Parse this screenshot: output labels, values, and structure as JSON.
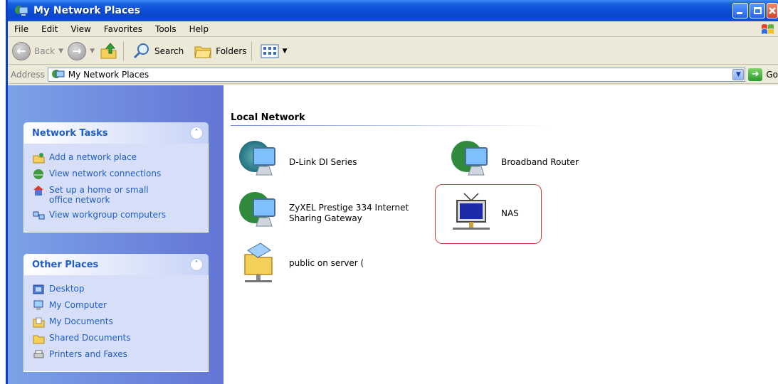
{
  "window": {
    "title": "My Network Places"
  },
  "menu": [
    "File",
    "Edit",
    "View",
    "Favorites",
    "Tools",
    "Help"
  ],
  "toolbar": {
    "back_label": "Back",
    "search_label": "Search",
    "folders_label": "Folders"
  },
  "address": {
    "label": "Address",
    "value": "My Network Places",
    "go_label": "Go"
  },
  "network_tasks": {
    "title": "Network Tasks",
    "items": [
      {
        "label": "Add a network place",
        "icon": "add-network-place-icon"
      },
      {
        "label": "View network connections",
        "icon": "network-connections-icon"
      },
      {
        "label": "Set up a home or small office network",
        "icon": "home-network-setup-icon"
      },
      {
        "label": "View workgroup computers",
        "icon": "workgroup-computers-icon"
      }
    ]
  },
  "other_places": {
    "title": "Other Places",
    "items": [
      {
        "label": "Desktop",
        "icon": "desktop-icon"
      },
      {
        "label": "My Computer",
        "icon": "my-computer-icon"
      },
      {
        "label": "My Documents",
        "icon": "my-documents-icon"
      },
      {
        "label": "Shared Documents",
        "icon": "shared-documents-icon"
      },
      {
        "label": "Printers and Faxes",
        "icon": "printers-faxes-icon"
      }
    ]
  },
  "local_network": {
    "title": "Local Network",
    "items": [
      {
        "label": "D-Link DI Series",
        "icon": "network-globe-computer-icon"
      },
      {
        "label": "Broadband Router",
        "icon": "network-globe-computer-icon"
      },
      {
        "label": "ZyXEL Prestige 334 Internet Sharing Gateway",
        "icon": "network-globe-computer-icon"
      },
      {
        "label": "NAS",
        "icon": "network-device-tv-icon"
      },
      {
        "label": "public on server (",
        "icon": "network-share-folder-icon"
      }
    ]
  },
  "colors": {
    "titlebar": "#0a4ed6",
    "taskpane": "#6375d6",
    "link": "#215dc6",
    "highlight": "#d23d3d"
  }
}
